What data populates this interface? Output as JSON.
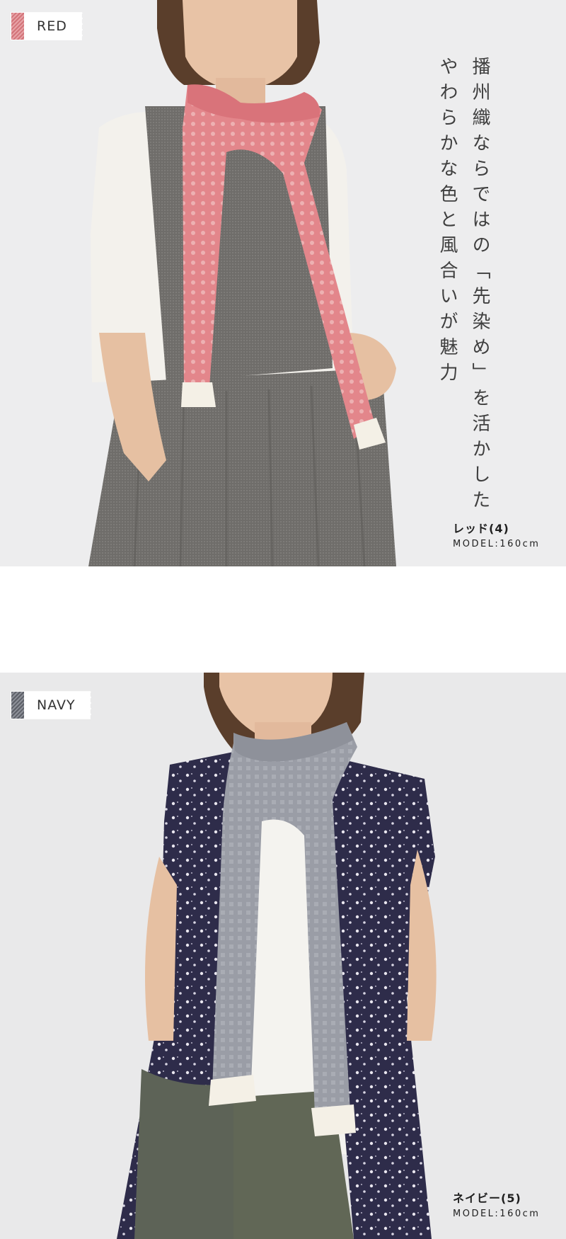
{
  "sections": [
    {
      "tag": "RED",
      "swatch_color": "#d3747a",
      "headline": [
        "播州織ならではの「先染め」を活かした",
        "やわらかな色と風合いが魅力"
      ],
      "caption_name": "レッド(4)",
      "caption_model": "MODEL:160cm"
    },
    {
      "tag": "NAVY",
      "swatch_color": "#5d6068",
      "caption_name": "ネイビー(5)",
      "caption_model": "MODEL:160cm"
    }
  ]
}
